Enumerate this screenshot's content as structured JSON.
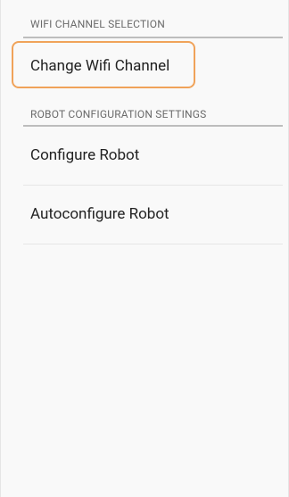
{
  "sections": [
    {
      "header": "WIFI CHANNEL SELECTION",
      "items": [
        {
          "label": "Change Wifi Channel"
        }
      ]
    },
    {
      "header": "ROBOT CONFIGURATION SETTINGS",
      "items": [
        {
          "label": "Configure Robot"
        },
        {
          "label": "Autoconfigure Robot"
        }
      ]
    }
  ],
  "colors": {
    "highlight": "#f0a35a",
    "background": "#f9f9f9",
    "text_primary": "#222222",
    "text_header": "#6b6b6b"
  }
}
